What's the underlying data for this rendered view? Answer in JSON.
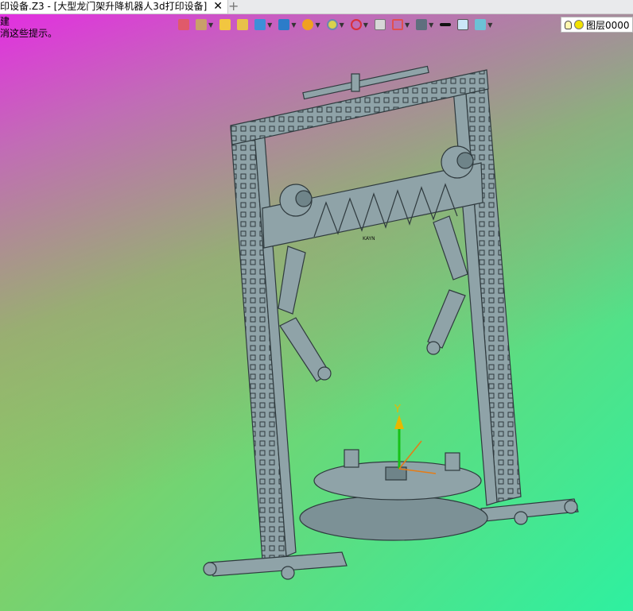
{
  "window": {
    "tab_title": "印设备.Z3 - [大型龙门架升降机器人3d打印设备]",
    "close_glyph": "✕",
    "new_tab_glyph": "+"
  },
  "prompt": {
    "line1": "建",
    "line2": "消这些提示。"
  },
  "toolbar": {
    "layer_label": "图层0000"
  },
  "axis": {
    "y_label": "Y"
  },
  "model": {
    "engraving": "KAYN"
  },
  "colors": {
    "frame": "#8fa3a8",
    "frame_dark": "#3a4448",
    "axis_green": "#17c117",
    "axis_yellow": "#e6b800",
    "axis_orange": "#e57c16"
  }
}
